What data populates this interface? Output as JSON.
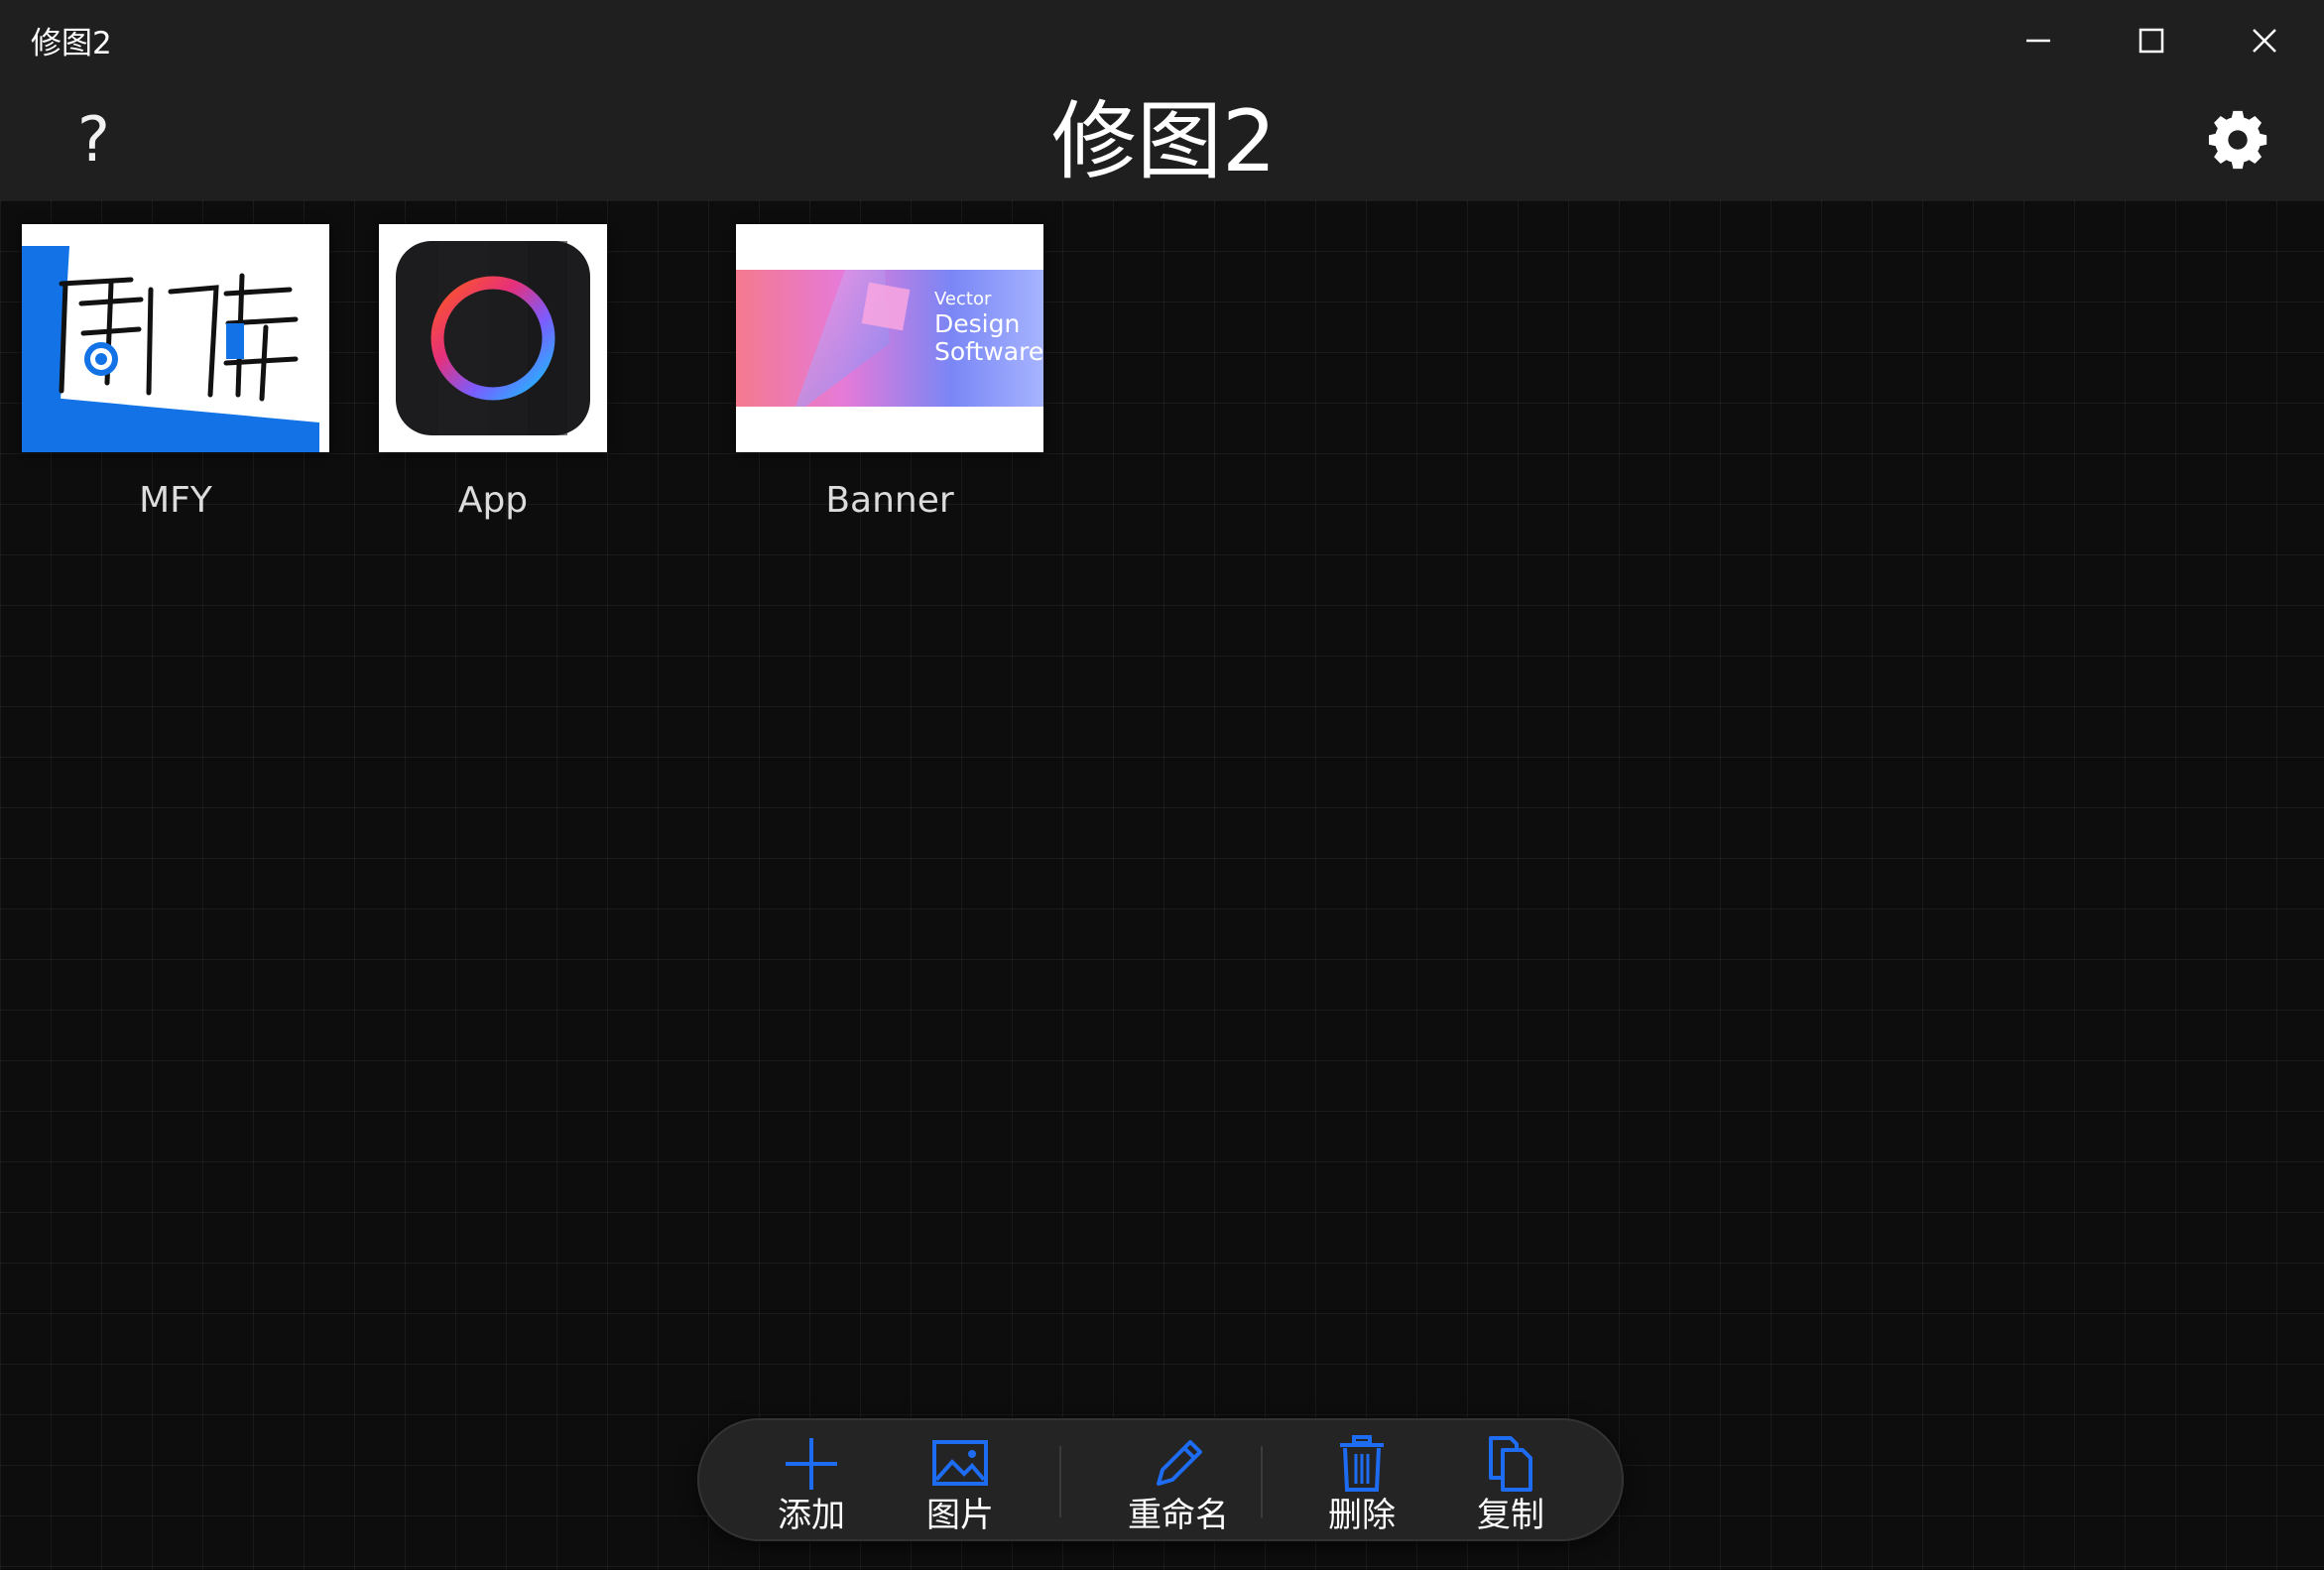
{
  "window": {
    "title": "修图2"
  },
  "header": {
    "help_label": "?",
    "title": "修图2"
  },
  "projects": [
    {
      "name": "MFY"
    },
    {
      "name": "App"
    },
    {
      "name": "Banner",
      "thumb_text_1": "Vector",
      "thumb_text_2": "Design",
      "thumb_text_3": "Software"
    }
  ],
  "toolbar": {
    "add_label": "添加",
    "image_label": "图片",
    "rename_label": "重命名",
    "delete_label": "删除",
    "copy_label": "复制"
  },
  "colors": {
    "accent": "#1e6cf2",
    "background": "#0d0d0e",
    "bar": "#1f1f20"
  }
}
